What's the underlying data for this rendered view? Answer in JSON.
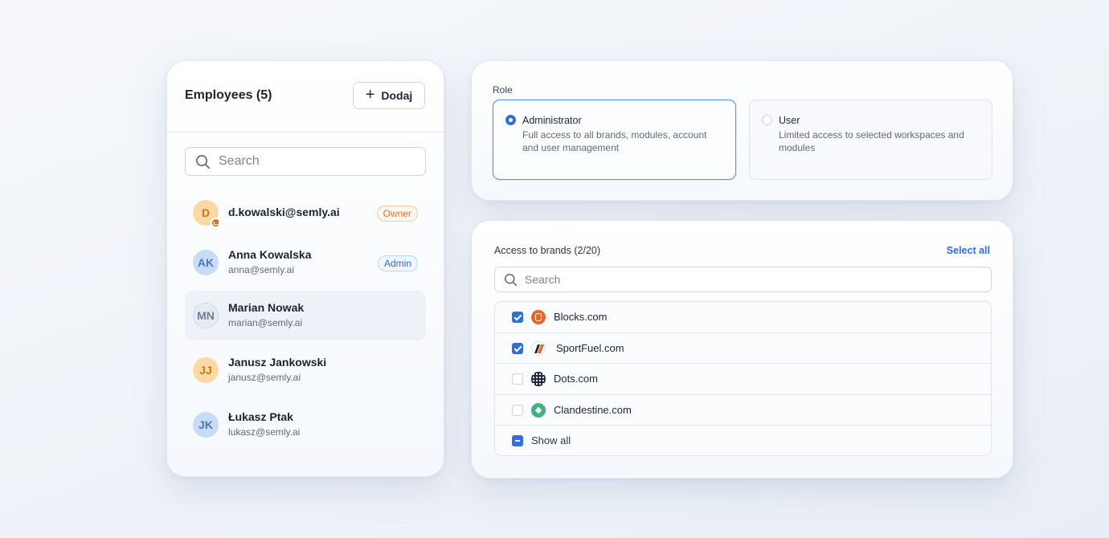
{
  "employees": {
    "title": "Employees (5)",
    "add_label": "Dodaj",
    "search_placeholder": "Search",
    "list": [
      {
        "initials": "D",
        "name": "d.kowalski@semly.ai",
        "email": "",
        "badge": "Owner",
        "color": "orange"
      },
      {
        "initials": "AK",
        "name": "Anna Kowalska",
        "email": "anna@semly.ai",
        "badge": "Admin",
        "color": "blue"
      },
      {
        "initials": "MN",
        "name": "Marian Nowak",
        "email": "marian@semly.ai",
        "badge": "",
        "color": "gray"
      },
      {
        "initials": "JJ",
        "name": "Janusz Jankowski",
        "email": "janusz@semly.ai",
        "badge": "",
        "color": "orange"
      },
      {
        "initials": "JK",
        "name": "Łukasz Ptak",
        "email": "lukasz@semly.ai",
        "badge": "",
        "color": "blue"
      }
    ]
  },
  "role": {
    "label": "Role",
    "options": [
      {
        "name": "Administrator",
        "description": "Full access to all brands, modules, account and user management",
        "selected": true
      },
      {
        "name": "User",
        "description": "Limited access to selected workspaces and modules",
        "selected": false
      }
    ]
  },
  "brands": {
    "label": "Access to brands (2/20)",
    "select_all": "Select all",
    "search_placeholder": "Search",
    "items": [
      {
        "name": "Blocks.com",
        "checked": true,
        "icon": "blocks-logo-icon"
      },
      {
        "name": "SportFuel.com",
        "checked": true,
        "icon": "sportfuel-logo-icon"
      },
      {
        "name": "Dots.com",
        "checked": false,
        "icon": "dots-logo-icon"
      },
      {
        "name": "Clandestine.com",
        "checked": false,
        "icon": "clandestine-logo-icon"
      }
    ],
    "show_all": "Show all"
  },
  "colors": {
    "accent": "#2f6fd6",
    "owner": "#e07a2c"
  }
}
